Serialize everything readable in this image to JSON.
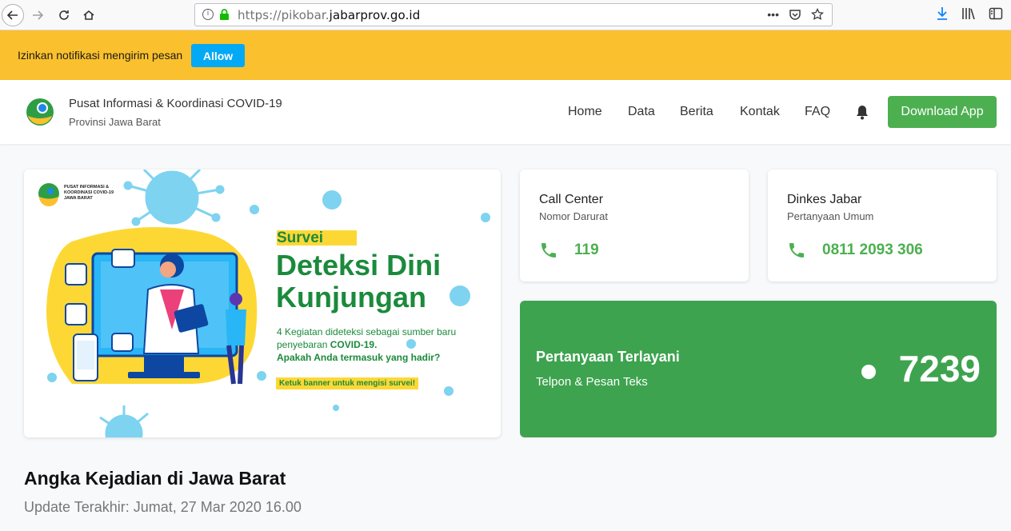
{
  "browser": {
    "url_prefix": "https://pikobar.",
    "url_domain": "jabarprov.go.id",
    "url_menu": "•••"
  },
  "notification": {
    "text": "Izinkan notifikasi mengirim pesan",
    "allow_label": "Allow"
  },
  "header": {
    "title": "Pusat Informasi & Koordinasi COVID-19",
    "subtitle": "Provinsi Jawa Barat",
    "nav": [
      "Home",
      "Data",
      "Berita",
      "Kontak",
      "FAQ"
    ],
    "download_label": "Download App"
  },
  "banner": {
    "logo_text": "PUSAT INFORMASI & KOORDINASI COVID-19 JAWA BARAT",
    "tag": "Survei",
    "title_line1": "Deteksi Dini",
    "title_line2": "Kunjungan",
    "desc_part1": "4 Kegiatan dideteksi sebagai sumber baru penyebaran ",
    "desc_bold1": "COVID-19.",
    "desc_bold2": "Apakah Anda termasuk yang hadir?",
    "cta": "Ketuk banner untuk mengisi survei!"
  },
  "cards": {
    "call_center": {
      "title": "Call Center",
      "subtitle": "Nomor Darurat",
      "number": "119"
    },
    "dinkes": {
      "title": "Dinkes Jabar",
      "subtitle": "Pertanyaan Umum",
      "number": "0811 2093 306"
    }
  },
  "stats": {
    "title": "Pertanyaan Terlayani",
    "subtitle": "Telpon & Pesan Teks",
    "value": "7239"
  },
  "section": {
    "title": "Angka Kejadian di Jawa Barat",
    "updated": "Update Terakhir: Jumat, 27 Mar 2020 16.00"
  },
  "colors": {
    "notification_bg": "#fbc02d",
    "allow_btn": "#03a9f4",
    "accent_green": "#4caf50",
    "stat_green": "#3ea34f",
    "banner_green": "#1b8a3c"
  }
}
